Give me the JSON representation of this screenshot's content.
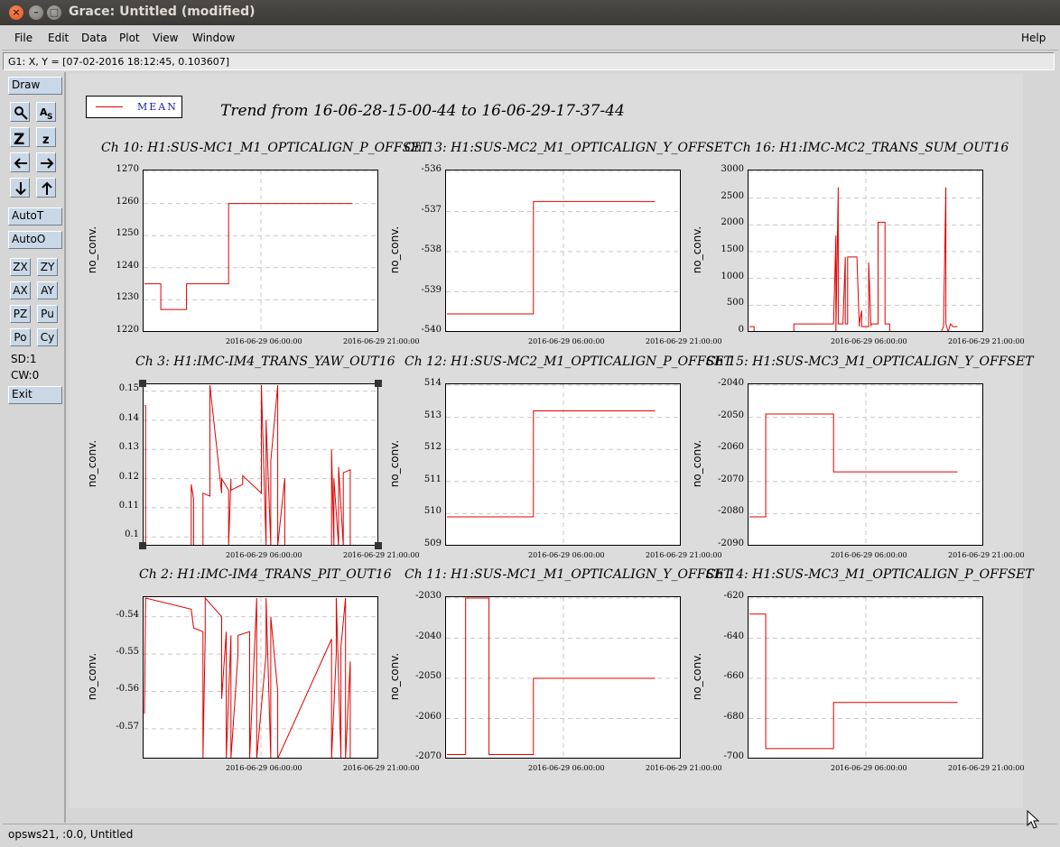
{
  "window": {
    "title": "Grace: Untitled (modified)",
    "close_glyph": "×",
    "min_glyph": "–",
    "max_glyph": "□"
  },
  "menu": {
    "items": [
      {
        "label": "File"
      },
      {
        "label": "Edit"
      },
      {
        "label": "Data"
      },
      {
        "label": "Plot"
      },
      {
        "label": "View"
      },
      {
        "label": "Window"
      }
    ],
    "help": "Help"
  },
  "locator": "G1: X, Y = [07-02-2016 18:12:45, 0.103607]",
  "toolbar": {
    "draw": "Draw",
    "autot": "AutoT",
    "autoo": "AutoO",
    "buttons": [
      "ZX",
      "ZY",
      "AX",
      "AY",
      "PZ",
      "Pu",
      "Po",
      "Cy"
    ],
    "sd": "SD:1",
    "cw": "CW:0",
    "exit": "Exit",
    "icons": [
      "zoom-icon",
      "autoscale-text-icon",
      "zoom-in-icon",
      "zoom-out-icon",
      "left-arrow-icon",
      "right-arrow-icon",
      "down-arrow-icon",
      "up-arrow-icon"
    ]
  },
  "plot": {
    "legend_label": "MEAN",
    "title": "Trend from 16-06-28-15-00-44 to 16-06-29-17-37-44",
    "line_color": "#e00000",
    "ylabel": "no_conv.",
    "xticks": [
      "2016-06-29 06:00:00",
      "2016-06-29 21:00:00"
    ]
  },
  "status": "opsws21, :0.0, Untitled",
  "chart_data": [
    {
      "type": "line",
      "title": "Ch 10: H1:SUS-MC1_M1_OPTICALIGN_P_OFFSET",
      "ylabel": "no_conv.",
      "ylim": [
        1220,
        1270
      ],
      "yticks": [
        "1270",
        "1260",
        "1250",
        "1240",
        "1230",
        "1220"
      ],
      "series": [
        {
          "x": [
            0,
            0.07,
            0.07,
            0.18,
            0.18,
            0.36,
            0.36,
            0.89
          ],
          "y": [
            1235,
            1235,
            1227,
            1227,
            1235,
            1235,
            1260,
            1260
          ]
        }
      ]
    },
    {
      "type": "line",
      "title": "Ch 13: H1:SUS-MC2_M1_OPTICALIGN_Y_OFFSET",
      "ylabel": "no_conv.",
      "ylim": [
        -540,
        -536
      ],
      "yticks": [
        "-536",
        "-537",
        "-538",
        "-539",
        "-540"
      ],
      "series": [
        {
          "x": [
            0,
            0.37,
            0.37,
            0.89
          ],
          "y": [
            -539.55,
            -539.55,
            -536.75,
            -536.75
          ]
        }
      ]
    },
    {
      "type": "line",
      "title": "Ch 16: H1:IMC-MC2_TRANS_SUM_OUT16",
      "ylabel": "no_conv.",
      "ylim": [
        0,
        3000
      ],
      "yticks": [
        "3000",
        "2500",
        "2000",
        "1500",
        "1000",
        "500",
        "0"
      ],
      "series": [
        {
          "x": [
            0,
            0.02,
            0.02,
            0.06,
            0.19,
            0.19,
            0.36,
            0.37,
            0.37,
            0.38,
            0.38,
            0.4,
            0.41,
            0.41,
            0.42,
            0.42,
            0.46,
            0.47,
            0.47,
            0.48,
            0.48,
            0.51,
            0.51,
            0.52,
            0.52,
            0.55,
            0.55,
            0.58,
            0.58,
            0.6,
            0.6,
            0.61,
            0.61,
            0.72,
            0.82,
            0.83,
            0.84,
            0.84,
            0.85,
            0.86,
            0.87,
            0.89
          ],
          "y": [
            100,
            100,
            0,
            0,
            0,
            150,
            150,
            1800,
            0,
            2700,
            150,
            150,
            1400,
            150,
            150,
            1400,
            1400,
            100,
            150,
            400,
            100,
            100,
            1300,
            100,
            150,
            150,
            2050,
            2050,
            150,
            150,
            0,
            0,
            0,
            0,
            0,
            100,
            2700,
            150,
            0,
            150,
            100,
            100
          ]
        }
      ]
    },
    {
      "type": "line",
      "title": "Ch 3: H1:IMC-IM4_TRANS_YAW_OUT16",
      "ylabel": "no_conv.",
      "ylim": [
        0.097,
        0.152
      ],
      "yticks": [
        "0.15",
        "0.14",
        "0.13",
        "0.12",
        "0.11",
        "0.1"
      ],
      "series": [
        {
          "x": [
            0,
            0.005,
            0.005,
            0.01,
            0.01,
            0.2,
            0.2,
            0.21,
            0.21,
            0.25,
            0.25,
            0.28,
            0.28,
            0.33,
            0.33,
            0.36,
            0.36,
            0.37,
            0.37,
            0.42,
            0.42,
            0.5,
            0.5,
            0.52,
            0.52,
            0.54,
            0.54,
            0.57,
            0.57,
            0.6,
            0.6,
            0.8,
            0.8,
            0.81,
            0.81,
            0.83,
            0.83,
            0.85,
            0.85,
            0.88,
            0.88
          ],
          "y": [
            0.145,
            0.145,
            0.097,
            0.097,
            0.097,
            0.097,
            0.118,
            0.113,
            0.097,
            0.097,
            0.115,
            0.114,
            0.152,
            0.115,
            0.12,
            0.116,
            0.097,
            0.12,
            0.116,
            0.118,
            0.121,
            0.115,
            0.152,
            0.097,
            0.14,
            0.097,
            0.126,
            0.152,
            0.097,
            0.12,
            0.097,
            0.097,
            0.13,
            0.097,
            0.12,
            0.097,
            0.124,
            0.097,
            0.122,
            0.123,
            0.097
          ]
        }
      ]
    },
    {
      "type": "line",
      "title": "Ch 12: H1:SUS-MC2_M1_OPTICALIGN_P_OFFSET",
      "ylabel": "no_conv.",
      "ylim": [
        509,
        514
      ],
      "yticks": [
        "514",
        "513",
        "512",
        "511",
        "510",
        "509"
      ],
      "series": [
        {
          "x": [
            0,
            0.37,
            0.37,
            0.89
          ],
          "y": [
            509.9,
            509.9,
            513.2,
            513.2
          ]
        }
      ]
    },
    {
      "type": "line",
      "title": "Ch 15: H1:SUS-MC3_M1_OPTICALIGN_Y_OFFSET",
      "ylabel": "no_conv.",
      "ylim": [
        -2090,
        -2040
      ],
      "yticks": [
        "-2040",
        "-2050",
        "-2060",
        "-2070",
        "-2080",
        "-2090"
      ],
      "series": [
        {
          "x": [
            0,
            0.07,
            0.07,
            0.36,
            0.36,
            0.89
          ],
          "y": [
            -2081,
            -2081,
            -2049,
            -2049,
            -2067,
            -2067
          ]
        }
      ]
    },
    {
      "type": "line",
      "title": "Ch 2: H1:IMC-IM4_TRANS_PIT_OUT16",
      "ylabel": "no_conv.",
      "ylim": [
        -0.578,
        -0.535
      ],
      "yticks": [
        "-0.54",
        "-0.55",
        "-0.56",
        "-0.57"
      ],
      "series": [
        {
          "x": [
            0,
            0.005,
            0.2,
            0.21,
            0.25,
            0.25,
            0.26,
            0.26,
            0.33,
            0.33,
            0.35,
            0.35,
            0.37,
            0.37,
            0.4,
            0.4,
            0.45,
            0.45,
            0.48,
            0.48,
            0.52,
            0.52,
            0.54,
            0.54,
            0.57,
            0.57,
            0.8,
            0.8,
            0.82,
            0.82,
            0.84,
            0.84,
            0.86,
            0.86,
            0.88,
            0.88
          ],
          "y": [
            -0.566,
            -0.535,
            -0.538,
            -0.543,
            -0.544,
            -0.578,
            -0.545,
            -0.535,
            -0.54,
            -0.562,
            -0.544,
            -0.578,
            -0.545,
            -0.578,
            -0.55,
            -0.545,
            -0.544,
            -0.578,
            -0.535,
            -0.578,
            -0.55,
            -0.535,
            -0.578,
            -0.54,
            -0.56,
            -0.578,
            -0.546,
            -0.578,
            -0.55,
            -0.535,
            -0.578,
            -0.548,
            -0.535,
            -0.578,
            -0.552,
            -0.578
          ]
        }
      ]
    },
    {
      "type": "line",
      "title": "Ch 11: H1:SUS-MC1_M1_OPTICALIGN_Y_OFFSET",
      "ylabel": "no_conv.",
      "ylim": [
        -2070,
        -2030
      ],
      "yticks": [
        "-2030",
        "-2040",
        "-2050",
        "-2060",
        "-2070"
      ],
      "series": [
        {
          "x": [
            0,
            0.08,
            0.08,
            0.09,
            0.18,
            0.18,
            0.37,
            0.37,
            0.89
          ],
          "y": [
            -2069,
            -2069,
            -2030,
            -2030,
            -2030,
            -2069,
            -2069,
            -2050,
            -2050
          ]
        }
      ]
    },
    {
      "type": "line",
      "title": "Ch 14: H1:SUS-MC3_M1_OPTICALIGN_P_OFFSET",
      "ylabel": "no_conv.",
      "ylim": [
        -700,
        -620
      ],
      "yticks": [
        "-620",
        "-640",
        "-660",
        "-680",
        "-700"
      ],
      "series": [
        {
          "x": [
            0,
            0.07,
            0.07,
            0.36,
            0.36,
            0.89
          ],
          "y": [
            -628,
            -628,
            -695,
            -695,
            -672,
            -672
          ]
        }
      ]
    }
  ]
}
